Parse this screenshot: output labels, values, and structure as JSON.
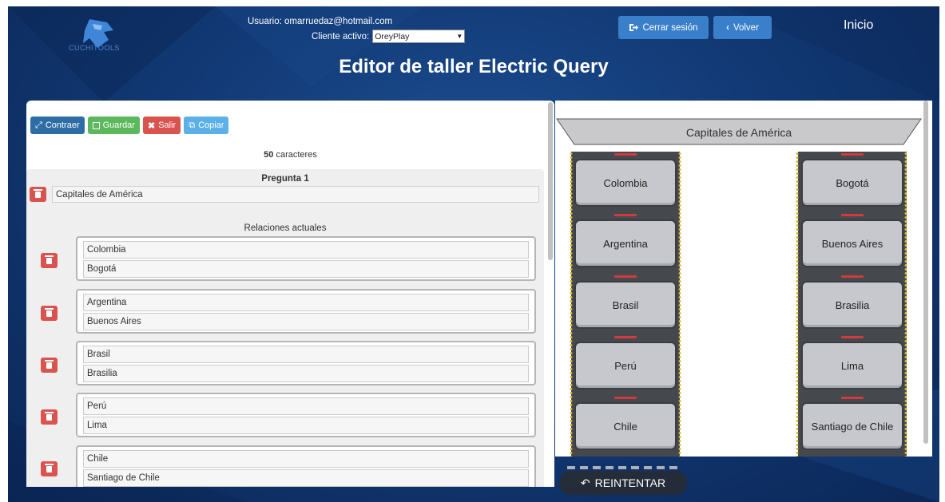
{
  "header": {
    "logo_text": "CUCHITOOLS",
    "user_label": "Usuario: omarruedaz@hotmail.com",
    "client_label": "Cliente activo:",
    "client_value": "OreyPlay",
    "logout_label": "Cerrar sesión",
    "back_label": "Volver",
    "home_label": "Inicio",
    "page_title": "Editor de taller Electric Query"
  },
  "toolbar": {
    "collapse_label": "Contraer",
    "save_label": "Guardar",
    "exit_label": "Salir",
    "copy_label": "Copiar"
  },
  "char_count": {
    "value": "50",
    "unit": "caracteres"
  },
  "question": {
    "title": "Pregunta 1",
    "text": "Capitales de América",
    "relations_label": "Relaciones actuales",
    "relations": [
      {
        "left": "Colombia",
        "right": "Bogotá"
      },
      {
        "left": "Argentina",
        "right": "Buenos Aires"
      },
      {
        "left": "Brasil",
        "right": "Brasilia"
      },
      {
        "left": "Perú",
        "right": "Lima"
      },
      {
        "left": "Chile",
        "right": "Santiago de Chile"
      }
    ]
  },
  "preview": {
    "title": "Capitales de América",
    "left_cards": [
      "Colombia",
      "Argentina",
      "Brasil",
      "Perú",
      "Chile"
    ],
    "right_cards": [
      "Bogotá",
      "Buenos Aires",
      "Brasilia",
      "Lima",
      "Santiago de Chile"
    ],
    "retry_label": "REINTENTAR"
  },
  "colors": {
    "primary": "#337ab7",
    "success": "#5cb85c",
    "danger": "#d9534f",
    "info": "#5bc0de",
    "header_button": "#3a7fc9",
    "background": "#123a76"
  }
}
